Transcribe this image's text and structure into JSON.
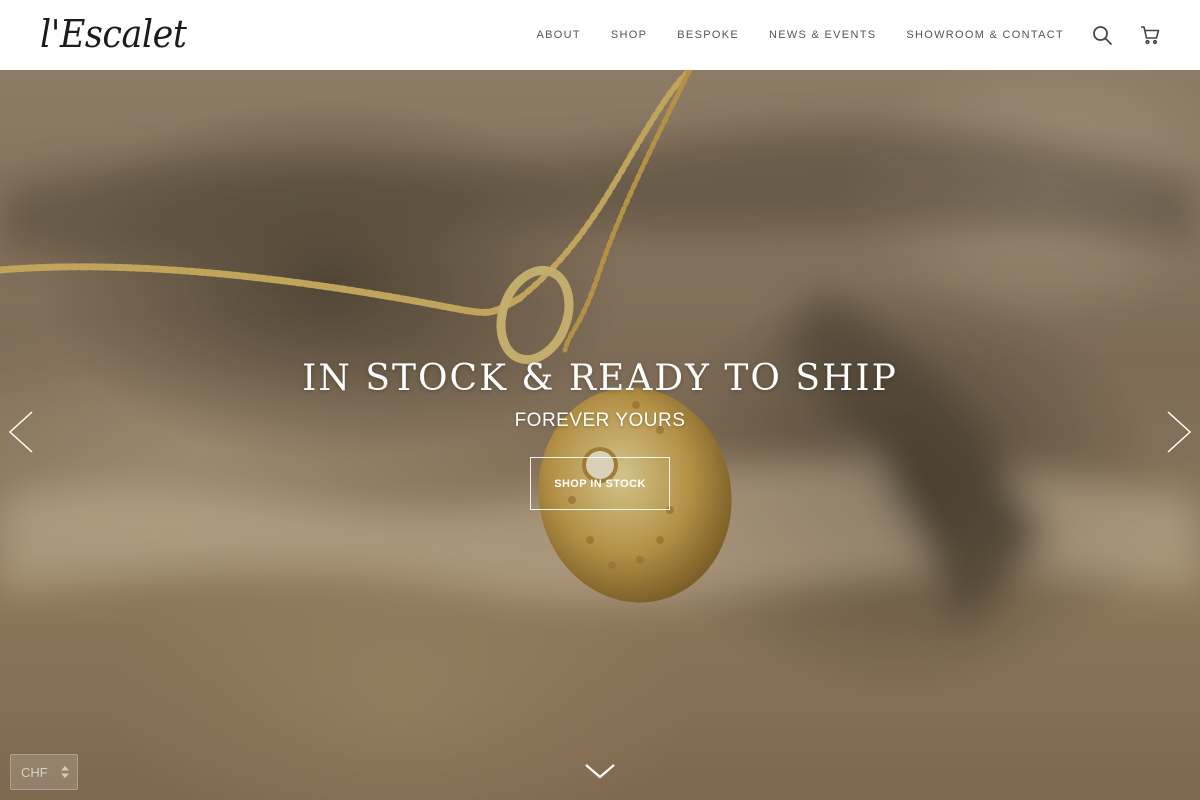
{
  "header": {
    "logo_text": "l'Escalet",
    "nav": [
      {
        "label": "ABOUT"
      },
      {
        "label": "SHOP"
      },
      {
        "label": "BESPOKE"
      },
      {
        "label": "NEWS & EVENTS"
      },
      {
        "label": "SHOWROOM & CONTACT"
      }
    ],
    "icons": {
      "search": "search-icon",
      "cart": "cart-icon"
    }
  },
  "hero": {
    "title": "IN STOCK & READY TO SHIP",
    "subtitle": "FOREVER YOURS",
    "cta_label": "SHOP IN STOCK",
    "icons": {
      "prev": "chevron-left-icon",
      "next": "chevron-right-icon",
      "scroll": "chevron-down-icon"
    }
  },
  "currency": {
    "selected": "CHF"
  },
  "colors": {
    "header_bg": "#ffffff",
    "nav_text": "#555555",
    "hero_text": "#ffffff",
    "gold": "#c9a24e"
  }
}
